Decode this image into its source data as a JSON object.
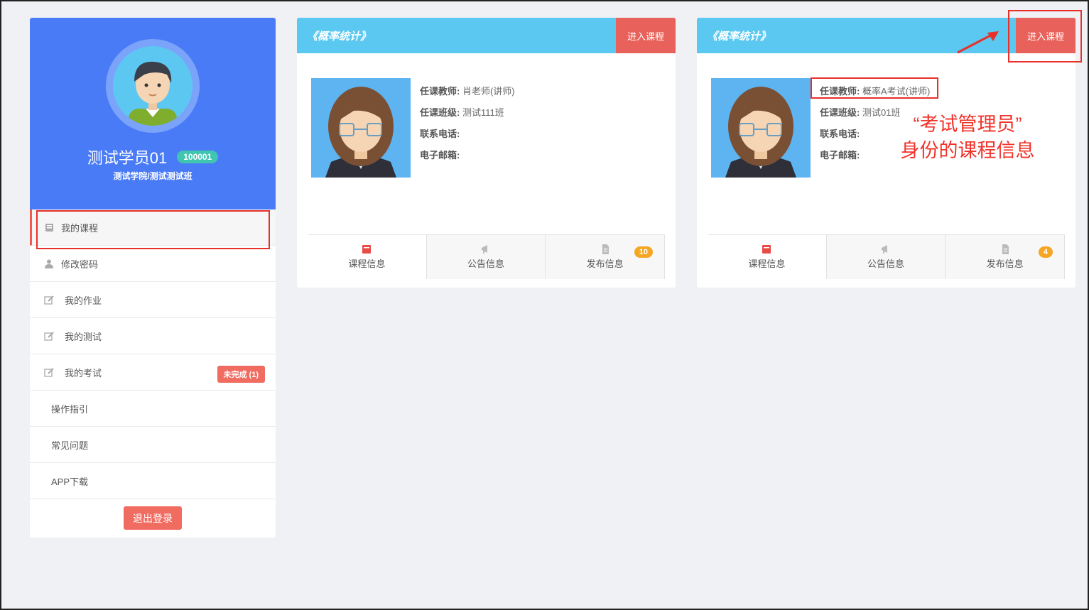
{
  "profile": {
    "name": "测试学员01",
    "id_badge": "100001",
    "org": "测试学院/测试测试班"
  },
  "menu": [
    {
      "label": "我的课程",
      "icon": "book-icon"
    },
    {
      "label": "修改密码",
      "icon": "user-icon"
    },
    {
      "label": "我的作业",
      "icon": "edit-icon"
    },
    {
      "label": "我的测试",
      "icon": "edit-icon"
    },
    {
      "label": "我的考试",
      "icon": "edit-icon",
      "badge": "未完成 (1)"
    },
    {
      "label": "操作指引"
    },
    {
      "label": "常见问题"
    },
    {
      "label": "APP下载"
    }
  ],
  "logout_label": "退出登录",
  "courses": [
    {
      "title": "《概率统计》",
      "enter_label": "进入课程",
      "teacher_key": "任课教师:",
      "teacher": "肖老师(讲师)",
      "class_key": "任课班级:",
      "class": "测试111班",
      "phone_key": "联系电话:",
      "email_key": "电子邮箱:",
      "tabs": [
        {
          "label": "课程信息",
          "icon": "book-icon"
        },
        {
          "label": "公告信息",
          "icon": "megaphone-icon"
        },
        {
          "label": "发布信息",
          "icon": "document-icon",
          "count": "10"
        }
      ]
    },
    {
      "title": "《概率统计》",
      "enter_label": "进入课程",
      "teacher_key": "任课教师:",
      "teacher": "概率A考试(讲师)",
      "class_key": "任课班级:",
      "class": "测试01班",
      "phone_key": "联系电话:",
      "email_key": "电子邮箱:",
      "tabs": [
        {
          "label": "课程信息",
          "icon": "book-icon"
        },
        {
          "label": "公告信息",
          "icon": "megaphone-icon"
        },
        {
          "label": "发布信息",
          "icon": "document-icon",
          "count": "4"
        }
      ]
    }
  ],
  "annotation": {
    "line1": "“考试管理员”",
    "line2": "身份的课程信息"
  },
  "colors": {
    "profile_bg": "#4a7bf7",
    "card_header": "#5ac8f0",
    "enter_button": "#e8615a",
    "badge_teal": "#3fc5b0",
    "count_orange": "#f5a623",
    "annotation_red": "#f0332a"
  }
}
